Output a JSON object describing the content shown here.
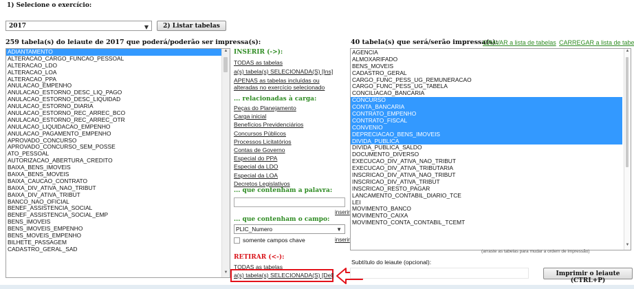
{
  "step1": {
    "label": "1) Selecione o exercício:",
    "year": "2017",
    "list_button": "2) Listar tabelas"
  },
  "left": {
    "header": "259 tabela(s) do leiaute de 2017 que poderá/poderão ser impressa(s):",
    "items": [
      {
        "label": "ADIANTAMENTO",
        "selected": true
      },
      {
        "label": "ALTERACAO_CARGO_FUNCAO_PESSOAL",
        "selected": false
      },
      {
        "label": "ALTERACAO_LDO",
        "selected": false
      },
      {
        "label": "ALTERACAO_LOA",
        "selected": false
      },
      {
        "label": "ALTERACAO_PPA",
        "selected": false
      },
      {
        "label": "ANULACAO_EMPENHO",
        "selected": false
      },
      {
        "label": "ANULACAO_ESTORNO_DESC_LIQ_PAGO",
        "selected": false
      },
      {
        "label": "ANULACAO_ESTORNO_DESC_LIQUIDAD",
        "selected": false
      },
      {
        "label": "ANULACAO_ESTORNO_DIARIA",
        "selected": false
      },
      {
        "label": "ANULACAO_ESTORNO_REC_ARREC_BCO",
        "selected": false
      },
      {
        "label": "ANULACAO_ESTORNO_REC_ARREC_OTR",
        "selected": false
      },
      {
        "label": "ANULACAO_LIQUIDACAO_EMPENHO",
        "selected": false
      },
      {
        "label": "ANULACAO_PAGAMENTO_EMPENHO",
        "selected": false
      },
      {
        "label": "APROVADO_CONCURSO",
        "selected": false
      },
      {
        "label": "APROVADO_CONCURSO_SEM_POSSE",
        "selected": false
      },
      {
        "label": "ATO_PESSOAL",
        "selected": false
      },
      {
        "label": "AUTORIZACAO_ABERTURA_CREDITO",
        "selected": false
      },
      {
        "label": "BAIXA_BENS_IMOVEIS",
        "selected": false
      },
      {
        "label": "BAIXA_BENS_MOVEIS",
        "selected": false
      },
      {
        "label": "BAIXA_CAUCAO_CONTRATO",
        "selected": false
      },
      {
        "label": "BAIXA_DIV_ATIVA_NAO_TRIBUT",
        "selected": false
      },
      {
        "label": "BAIXA_DIV_ATIVA_TRIBUT",
        "selected": false
      },
      {
        "label": "BANCO_NAO_OFICIAL",
        "selected": false
      },
      {
        "label": "BENEF_ASSISTENCIA_SOCIAL",
        "selected": false
      },
      {
        "label": "BENEF_ASSISTENCIA_SOCIAL_EMP",
        "selected": false
      },
      {
        "label": "BENS_IMOVEIS",
        "selected": false
      },
      {
        "label": "BENS_IMOVEIS_EMPENHO",
        "selected": false
      },
      {
        "label": "BENS_MOVEIS_EMPENHO",
        "selected": false
      },
      {
        "label": "BILHETE_PASSAGEM",
        "selected": false
      },
      {
        "label": "CADASTRO_GERAL_SAD",
        "selected": false
      }
    ]
  },
  "middle": {
    "inserir_title": "INSERIR (->):",
    "inserir_links": [
      "TODAS as tabelas",
      "a(s) tabela(s) SELECIONADA(S) [Ins]",
      "APENAS as tabelas incluídas ou alteradas no exercício selecionado"
    ],
    "related_title": "... relacionadas à carga:",
    "related_links": [
      "Peças do Planejamento",
      "Carga inicial",
      "Benefícios Previdenciários",
      "Concursos Públicos",
      "Processos Licitatórios",
      "Contas de Governo",
      "Especial do PPA",
      "Especial da LDO",
      "Especial da LOA",
      "Decretos Legislativos"
    ],
    "word_title": "... que contenham a palavra:",
    "word_value": "",
    "inserir_short": "inserir",
    "field_title": "... que contenham o campo:",
    "field_select": "PLIC_Numero",
    "key_only_label": "somente campos chave",
    "key_only_checked": false,
    "retirar_title": "RETIRAR (<-):",
    "retirar_links": [
      "TODAS as tabelas",
      "a(s) tabela(s) SELECIONADA(S) [Del]"
    ]
  },
  "right": {
    "header": "40 tabela(s) que será/serão impressa(s):",
    "save_link": "GRAVAR a lista de tabelas",
    "load_link": "CARREGAR a lista de tabelas",
    "items": [
      {
        "label": "AGENCIA",
        "selected": false
      },
      {
        "label": "ALMOXARIFADO",
        "selected": false
      },
      {
        "label": "BENS_MOVEIS",
        "selected": false
      },
      {
        "label": "CADASTRO_GERAL",
        "selected": false
      },
      {
        "label": "CARGO_FUNC_PESS_UG_REMUNERACAO",
        "selected": false
      },
      {
        "label": "CARGO_FUNC_PESS_UG_TABELA",
        "selected": false
      },
      {
        "label": "CONCILIACAO_BANCARIA",
        "selected": false
      },
      {
        "label": "CONCURSO",
        "selected": true
      },
      {
        "label": "CONTA_BANCARIA",
        "selected": true
      },
      {
        "label": "CONTRATO_EMPENHO",
        "selected": true
      },
      {
        "label": "CONTRATO_FISCAL",
        "selected": true
      },
      {
        "label": "CONVENIO",
        "selected": true
      },
      {
        "label": "DEPRECIACAO_BENS_IMOVEIS",
        "selected": true
      },
      {
        "label": "DIVIDA_PUBLICA",
        "selected": true
      },
      {
        "label": "DIVIDA_PUBLICA_SALDO",
        "selected": false
      },
      {
        "label": "DOCUMENTO_DIVERSO",
        "selected": false
      },
      {
        "label": "EXECUCAO_DIV_ATIVA_NAO_TRIBUT",
        "selected": false
      },
      {
        "label": "EXECUCAO_DIV_ATIVA_TRIBUTARIA",
        "selected": false
      },
      {
        "label": "INSCRICAO_DIV_ATIVA_NAO_TRIBUT",
        "selected": false
      },
      {
        "label": "INSCRICAO_DIV_ATIVA_TRIBUT",
        "selected": false
      },
      {
        "label": "INSCRICAO_RESTO_PAGAR",
        "selected": false
      },
      {
        "label": "LANCAMENTO_CONTABIL_DIARIO_TCE",
        "selected": false
      },
      {
        "label": "LEI",
        "selected": false
      },
      {
        "label": "MOVIMENTO_BANCO",
        "selected": false
      },
      {
        "label": "MOVIMENTO_CAIXA",
        "selected": false
      },
      {
        "label": "MOVIMENTO_CONTA_CONTABIL_TCEMT",
        "selected": false
      }
    ],
    "drag_hint": "(arraste as tabelas para mudar a ordem de impressão)",
    "subtitle_label": "Subtítulo do leiaute (opcional):",
    "subtitle_value": "",
    "print_button": "Imprimir o leiaute (CTRL+P)"
  },
  "colors": {
    "selection": "#3399ff",
    "green_link": "#2e8b22",
    "red_title": "#d9141b",
    "highlight_box": "#e3131b"
  }
}
